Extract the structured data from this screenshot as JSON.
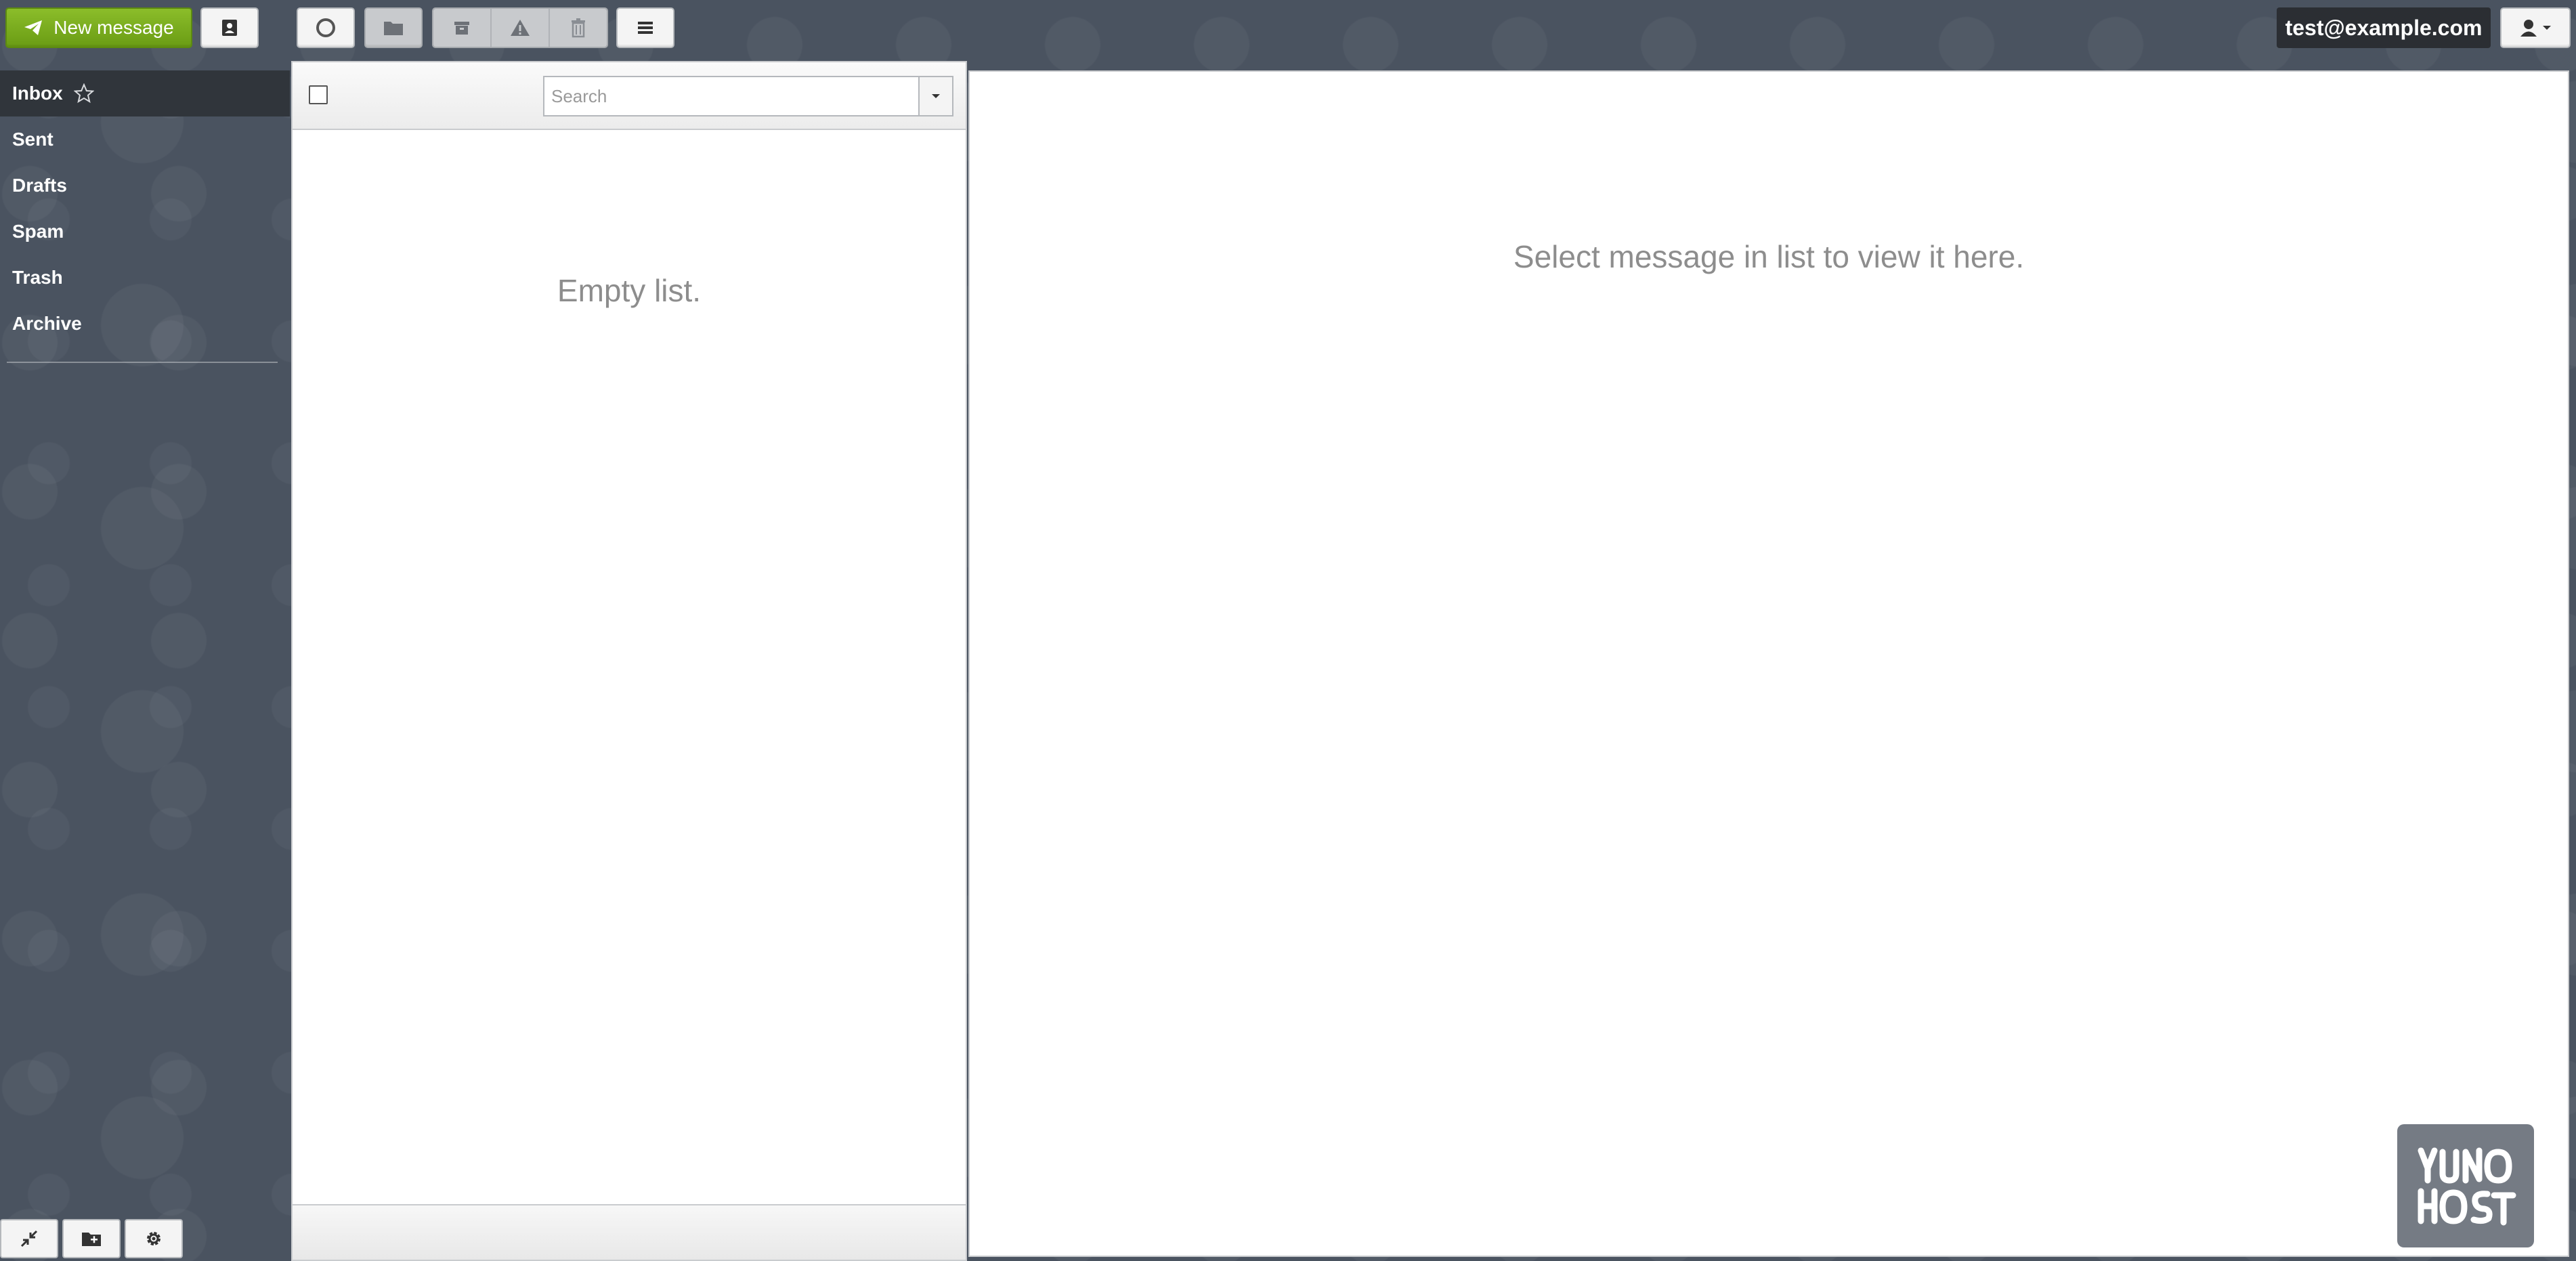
{
  "toolbar": {
    "new_message_label": "New message",
    "account_email": "test@example.com"
  },
  "sidebar": {
    "folders": [
      {
        "label": "Inbox",
        "active": true
      },
      {
        "label": "Sent"
      },
      {
        "label": "Drafts"
      },
      {
        "label": "Spam"
      },
      {
        "label": "Trash"
      },
      {
        "label": "Archive"
      }
    ]
  },
  "message_list": {
    "search_placeholder": "Search",
    "empty_text": "Empty list."
  },
  "preview": {
    "placeholder_text": "Select message in list to view it here."
  },
  "icons": {
    "new_message": "paper-plane-icon",
    "contacts": "contacts-card-icon",
    "refresh": "refresh-icon",
    "move": "folder-icon",
    "archive": "archive-box-icon",
    "spam": "warning-icon",
    "delete": "trash-icon",
    "menu": "menu-icon",
    "user": "user-icon",
    "collapse": "collapse-icon",
    "create_folder": "add-folder-icon",
    "settings": "gear-icon",
    "star": "star-icon"
  },
  "colors": {
    "accent_green": "#7aad1e",
    "background": "#4a5360",
    "active_folder": "#30353b",
    "muted_text": "#8d8d8d"
  }
}
